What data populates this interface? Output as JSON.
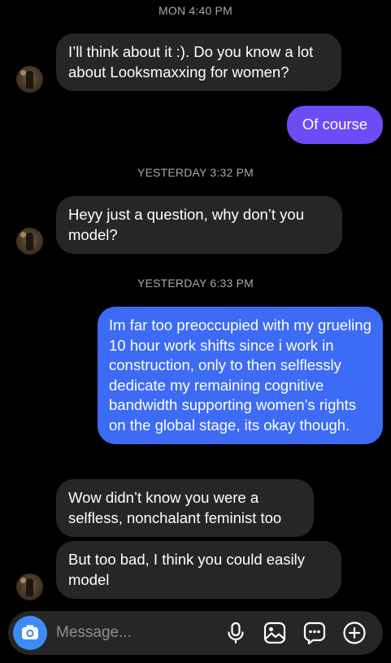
{
  "timestamps": [
    "MON 4:40 PM",
    "YESTERDAY 3:32 PM",
    "YESTERDAY 6:33 PM"
  ],
  "messages": [
    {
      "from": "them",
      "text": "I’ll think about it :). Do you know a lot about Looksmaxxing for women?"
    },
    {
      "from": "me",
      "text": "Of course"
    },
    {
      "from": "them",
      "text": "Heyy just a question, why don’t you model?"
    },
    {
      "from": "me",
      "text": "Im far too preoccupied with my grueling 10 hour work shifts since i work in construction, only to then selflessly dedicate my remaining cognitive bandwidth supporting women’s rights on the global stage, its okay though."
    },
    {
      "from": "them",
      "text": "Wow didn’t know you were a selfless, nonchalant feminist too"
    },
    {
      "from": "them",
      "text": "But too bad, I think you could easily model"
    }
  ],
  "composer": {
    "placeholder": "Message...",
    "icons": [
      "camera-icon",
      "microphone-icon",
      "gallery-icon",
      "sticker-icon",
      "add-icon"
    ]
  },
  "colors": {
    "background": "#000000",
    "received_bubble": "#262626",
    "sent_bubble_purple": "#6b4cf6",
    "sent_bubble_blue": "#3d6bf5",
    "camera_button": "#3d8bf7",
    "timestamp": "#a8a8a8",
    "placeholder": "#8e8e8e"
  }
}
